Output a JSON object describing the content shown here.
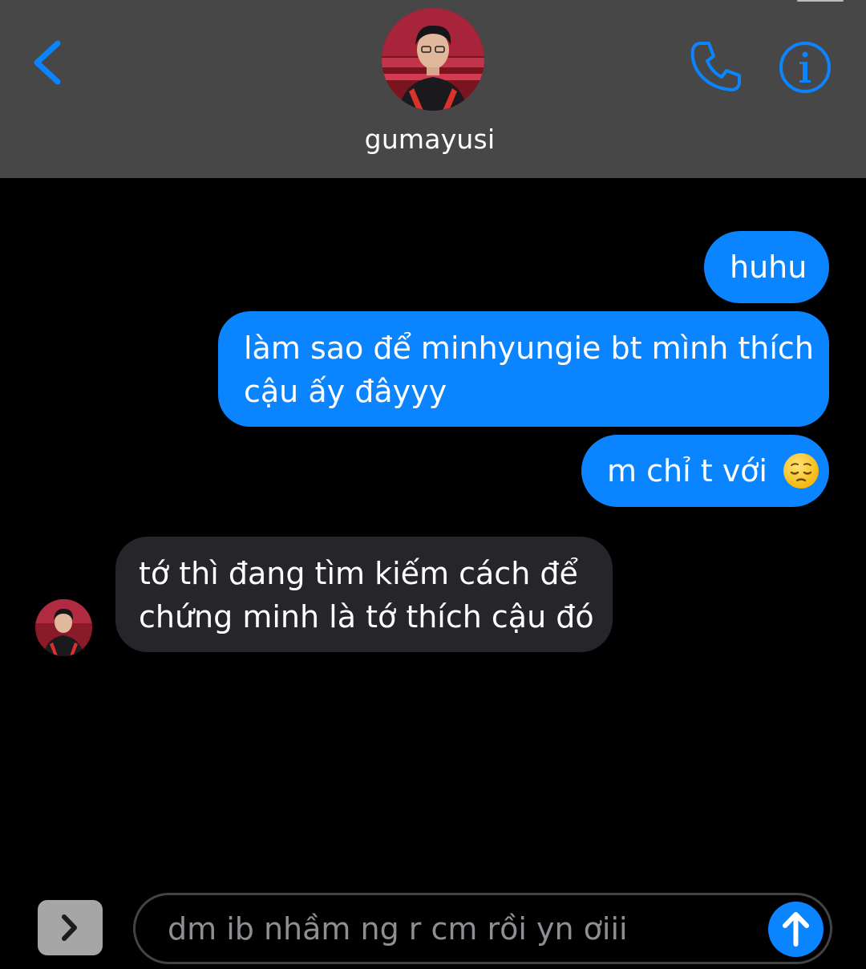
{
  "header": {
    "contact_name": "gumayusi",
    "back_icon": "chevron-left-icon",
    "call_icon": "phone-icon",
    "info_icon": "info-circle-icon",
    "background_color": "#474747",
    "accent_color": "#0a84ff"
  },
  "messages": [
    {
      "direction": "outgoing",
      "text": "huhu"
    },
    {
      "direction": "outgoing",
      "text": "làm sao để minhyungie bt mình thích",
      "text_line2": "cậu ấy đâyyy"
    },
    {
      "direction": "outgoing",
      "text": "m chỉ t với",
      "emoji": "pensive-face"
    },
    {
      "direction": "incoming",
      "text": "tớ thì đang tìm kiếm cách để",
      "text_line2": "chứng minh là tớ thích cậu đó"
    }
  ],
  "composer": {
    "text": "dm ib nhầm ng r cm rồi yn ơiii",
    "expand_icon": "chevron-right-icon",
    "send_icon": "arrow-up-icon"
  },
  "colors": {
    "outgoing_bubble": "#0a84ff",
    "incoming_bubble": "#26252a",
    "background": "#000000"
  }
}
